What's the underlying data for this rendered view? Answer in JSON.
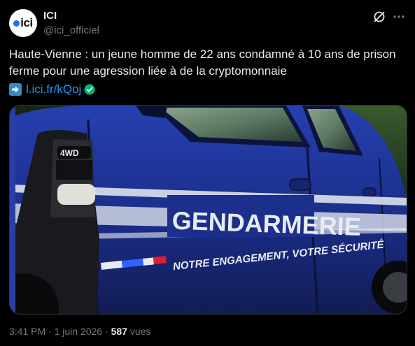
{
  "author": {
    "avatar_text": "ici",
    "display_name": "ICI",
    "handle": "@ici_officiel"
  },
  "tweet": {
    "text": "Haute-Vienne : un jeune homme de 22 ans condamné à 10 ans de prison ferme pour une agression liée à de la cryptomonnaie",
    "link_text": "l.ici.fr/kQoj",
    "link_emoji": "arrow-right-emoji"
  },
  "media": {
    "vehicle_badge": "4WD",
    "vehicle_label": "GENDARMERIE",
    "vehicle_slogan": "NOTRE ENGAGEMENT, VOTRE SÉCURITÉ"
  },
  "meta": {
    "time": "3:41 PM",
    "date": "1 juin 2026",
    "views_count": "587",
    "views_label": "vues"
  },
  "icons": [
    "grok-icon",
    "more-icon",
    "verified-icon"
  ],
  "colors": {
    "background": "#000000",
    "text": "#e7e9ea",
    "secondary": "#71767b",
    "link": "#1d9bf0",
    "van_blue": "#1d2f8a"
  }
}
